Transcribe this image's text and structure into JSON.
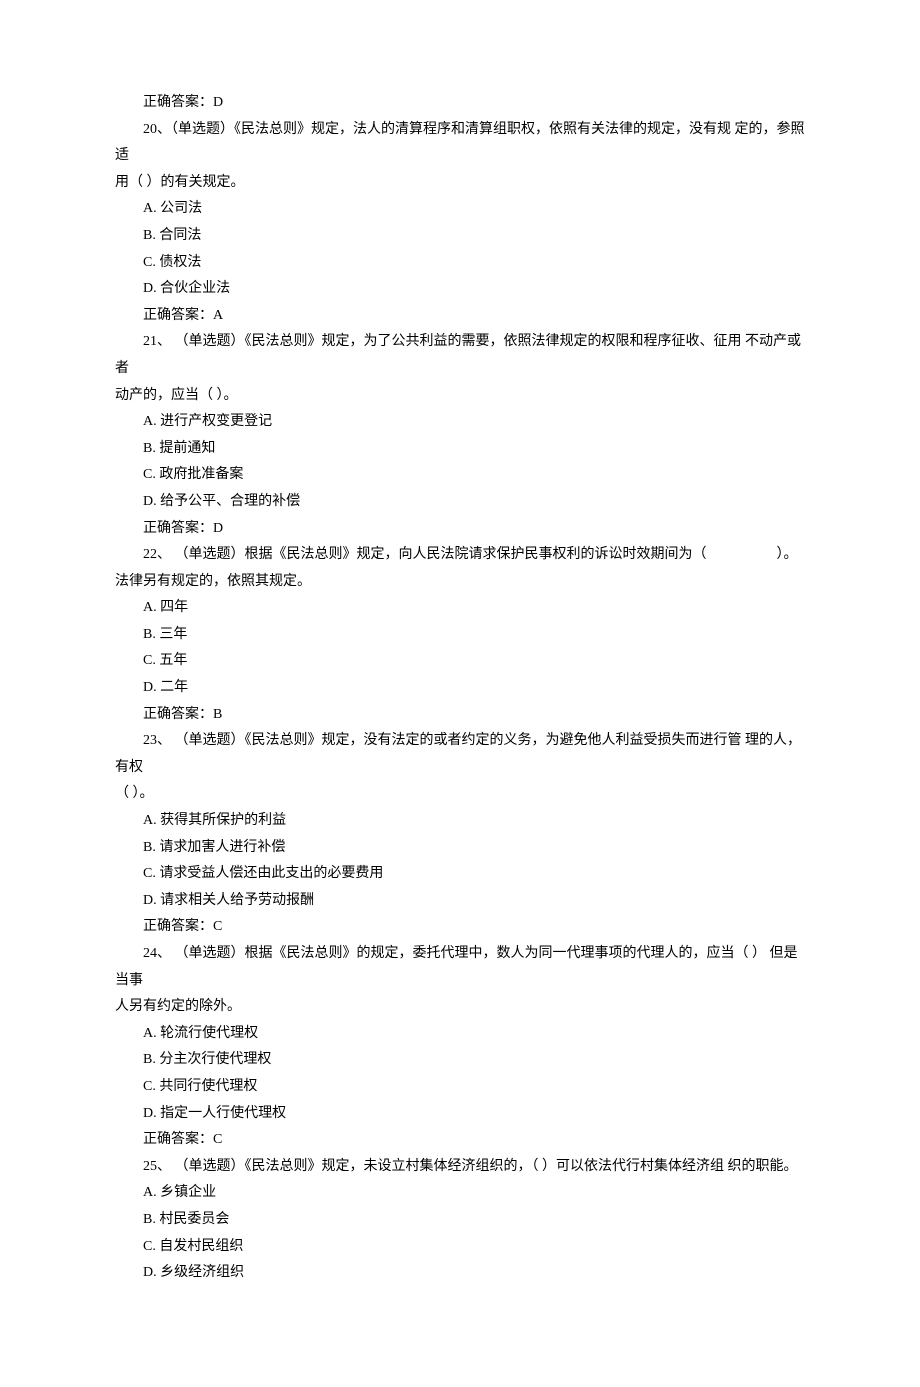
{
  "preanswer": {
    "label_prefix": "正确答案：",
    "value": "D"
  },
  "questions": [
    {
      "number": "20、",
      "type_label": "（单选题）",
      "stem_line1": "《民法总则》规定，法人的清算程序和清算组职权，依照有关法律的规定，没有规 定的，参照适",
      "stem_line2": "用（ ）的有关规定。",
      "options": [
        "A. 公司法",
        "B. 合同法",
        "C. 债权法",
        "D. 合伙企业法"
      ],
      "answer_prefix": "正确答案：",
      "answer": "A"
    },
    {
      "number": "21、",
      "type_label": " （单选题）",
      "stem_line1": "《民法总则》规定，为了公共利益的需要，依照法律规定的权限和程序征收、征用 不动产或者",
      "stem_line2": "动产的，应当（ ）。",
      "options": [
        "A. 进行产权变更登记",
        "B. 提前通知",
        "C. 政府批准备案",
        "D. 给予公平、合理的补偿"
      ],
      "answer_prefix": "正确答案：",
      "answer": "D"
    },
    {
      "number": "22、",
      "type_label": " （单选题）",
      "stem_line1": "根据《民法总则》规定，向人民法院请求保护民事权利的诉讼时效期间为（　　　　　）。",
      "stem_line2": "法律另有规定的，依照其规定。",
      "options": [
        "A. 四年",
        "B. 三年",
        "C. 五年",
        "D. 二年"
      ],
      "answer_prefix": "正确答案：",
      "answer": "B"
    },
    {
      "number": "23、",
      "type_label": " （单选题）",
      "stem_line1": "《民法总则》规定，没有法定的或者约定的义务，为避免他人利益受损失而进行管 理的人，有权",
      "stem_line2": "（ ）。",
      "options": [
        "A. 获得其所保护的利益",
        "B. 请求加害人进行补偿",
        "C. 请求受益人偿还由此支出的必要费用",
        "D. 请求相关人给予劳动报酬"
      ],
      "answer_prefix": "正确答案：",
      "answer": "C"
    },
    {
      "number": "24、",
      "type_label": " （单选题）",
      "stem_line1": "根据《民法总则》的规定，委托代理中，数人为同一代理事项的代理人的，应当（ ） 但是当事",
      "stem_line2": "人另有约定的除外。",
      "options": [
        "A. 轮流行使代理权",
        "B. 分主次行使代理权",
        "C. 共同行使代理权",
        "D. 指定一人行使代理权"
      ],
      "answer_prefix": "正确答案：",
      "answer": "C"
    },
    {
      "number": "25、",
      "type_label": " （单选题）",
      "stem_line1": "《民法总则》规定，未设立村集体经济组织的，（ ）可以依法代行村集体经济组 织的职能。",
      "stem_line2": "",
      "options": [
        "A. 乡镇企业",
        "B. 村民委员会",
        "C. 自发村民组织",
        "D. 乡级经济组织"
      ],
      "answer_prefix": "",
      "answer": ""
    }
  ]
}
